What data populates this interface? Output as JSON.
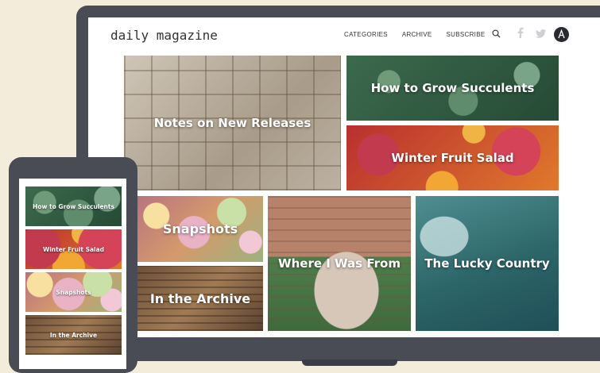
{
  "site": {
    "logo": "daily magazine",
    "nav": [
      "CATEGORIES",
      "ARCHIVE",
      "SUBSCRIBE"
    ],
    "icons": [
      "search-icon",
      "facebook-icon",
      "twitter-icon",
      "avatar-icon"
    ]
  },
  "articles": [
    "Notes on New Releases",
    "How to Grow Succulents",
    "Winter Fruit Salad",
    "Snapshots",
    "In the Archive",
    "Where I Was From",
    "The Lucky Country"
  ],
  "mobile": {
    "articles": [
      "How to Grow Succulents",
      "Winter Fruit Salad",
      "Snapshots",
      "In the Archive"
    ]
  },
  "colors": {
    "background": "#f3ecdb",
    "device": "#4a4c55",
    "screen": "#ffffff"
  }
}
